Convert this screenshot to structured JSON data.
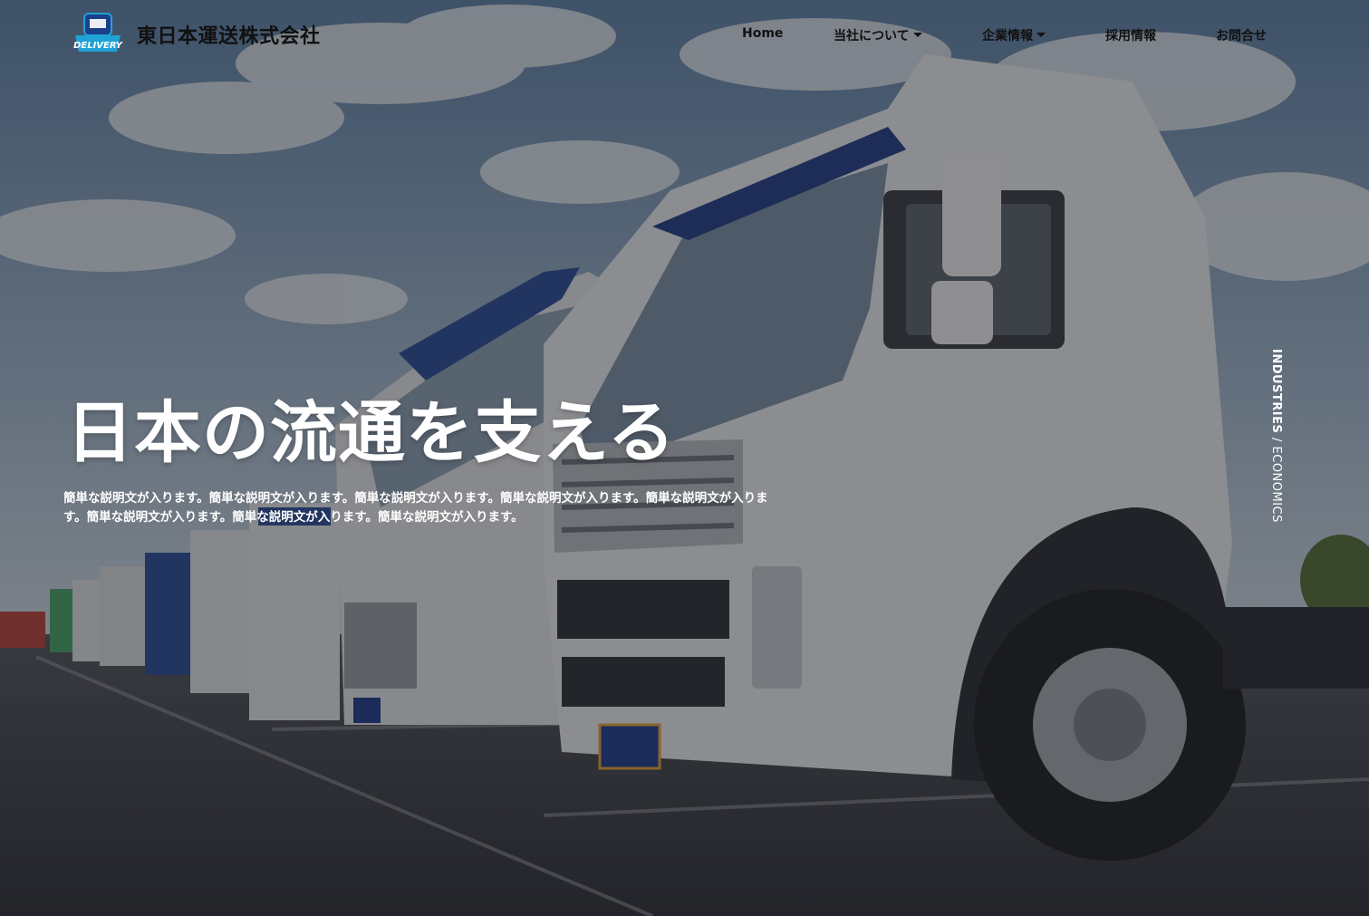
{
  "header": {
    "logo_text": "DELIVERY",
    "company_name": "東日本運送株式会社"
  },
  "nav": {
    "items": [
      {
        "label": "Home",
        "has_dropdown": false
      },
      {
        "label": "当社について",
        "has_dropdown": true
      },
      {
        "label": "企業情報",
        "has_dropdown": true
      },
      {
        "label": "採用情報",
        "has_dropdown": false
      },
      {
        "label": "お問合せ",
        "has_dropdown": false
      }
    ]
  },
  "hero": {
    "headline": "日本の流通を支える",
    "description": "簡単な説明文が入ります。簡単な説明文が入ります。簡単な説明文が入ります。簡単な説明文が入ります。簡単な説明文が入ります。簡単な説明文が入ります。簡単な説明文が入ります。簡単な説明文が入ります。",
    "side_label_strong": "INDUSTRIES",
    "side_label_rest": " / ECONOMICS"
  },
  "colors": {
    "sky_top": "#6b8fb3",
    "sky_bottom": "#c9d6e3",
    "asphalt": "#3d4047",
    "truck_white": "#e8eaec",
    "truck_blue": "#2d4f9a",
    "logo_blue": "#1fa3d6"
  }
}
